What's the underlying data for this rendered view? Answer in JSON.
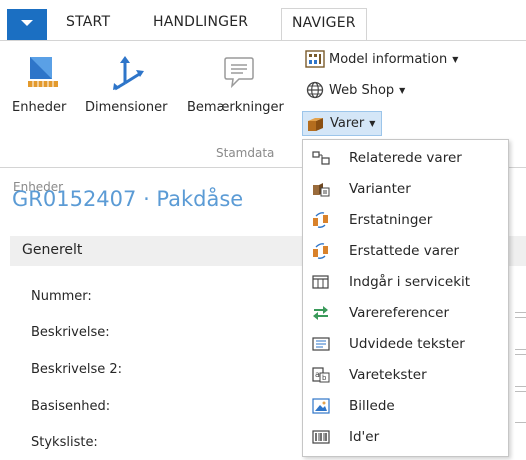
{
  "tabs": {
    "start": "START",
    "handlinger": "HANDLINGER",
    "naviger": "NAVIGER"
  },
  "ribbon": {
    "enheder": "Enheder",
    "dimensioner": "Dimensioner",
    "bemaerkninger": "Bemærkninger",
    "group_label": "Stamdata",
    "model_information": "Model information",
    "web_shop": "Web Shop",
    "varer": "Varer"
  },
  "page": {
    "breadcrumb": "Enheder",
    "title": "GR0152407 · Pakdåse",
    "section": "Generelt",
    "fields": [
      "Nummer:",
      "Beskrivelse:",
      "Beskrivelse 2:",
      "Basisenhed:",
      "Styksliste:"
    ]
  },
  "dropdown": {
    "items": [
      {
        "label": "Relaterede varer",
        "icon": "related-items-icon"
      },
      {
        "label": "Varianter",
        "icon": "variants-icon"
      },
      {
        "label": "Erstatninger",
        "icon": "substitutions-icon"
      },
      {
        "label": "Erstattede varer",
        "icon": "substituted-items-icon"
      },
      {
        "label": "Indgår i servicekit",
        "icon": "service-kit-icon"
      },
      {
        "label": "Varereferencer",
        "icon": "item-references-icon"
      },
      {
        "label": "Udvidede tekster",
        "icon": "extended-texts-icon"
      },
      {
        "label": "Varetekster",
        "icon": "item-texts-icon"
      },
      {
        "label": "Billede",
        "icon": "picture-icon"
      },
      {
        "label": "Id'er",
        "icon": "ids-icon"
      }
    ]
  },
  "colors": {
    "accent": "#1b6fc2",
    "title": "#5b9bd5",
    "highlight": "#d4e6f7"
  }
}
